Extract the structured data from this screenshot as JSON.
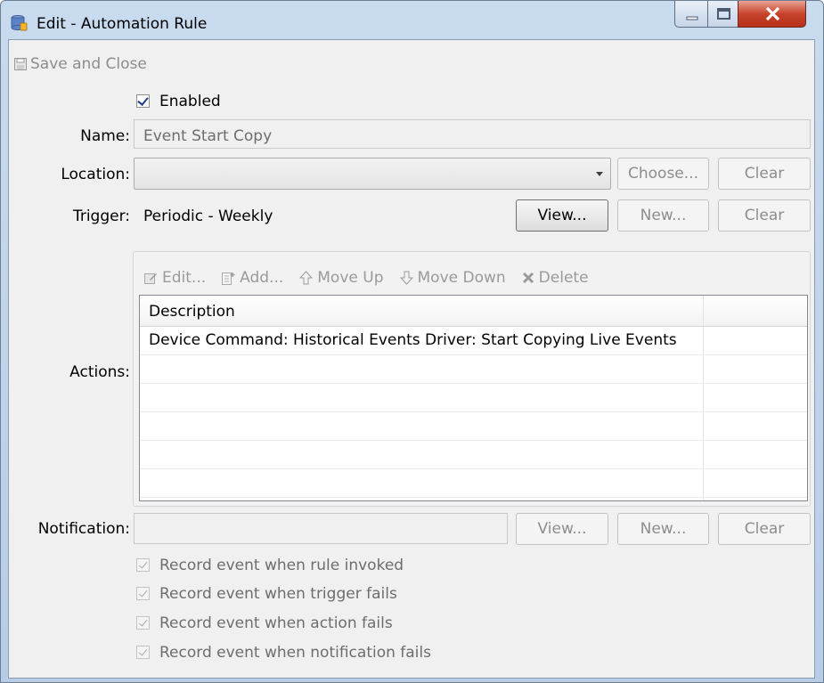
{
  "window": {
    "title": "Edit - Automation Rule",
    "min_icon": "minimize-icon",
    "max_icon": "maximize-icon",
    "close_icon": "close-icon",
    "close_color": "#c7422c"
  },
  "toolbar": {
    "save_close_label": "Save and Close"
  },
  "enabled": {
    "label": "Enabled",
    "checked": true
  },
  "name": {
    "label": "Name:",
    "value": "Event Start Copy"
  },
  "location": {
    "label": "Location:",
    "value": "",
    "choose_label": "Choose...",
    "clear_label": "Clear"
  },
  "trigger": {
    "label": "Trigger:",
    "value": "Periodic - Weekly",
    "view_label": "View...",
    "new_label": "New...",
    "clear_label": "Clear"
  },
  "actions": {
    "label": "Actions:",
    "toolbar": {
      "edit": "Edit...",
      "add": "Add...",
      "move_up": "Move Up",
      "move_down": "Move Down",
      "delete": "Delete"
    },
    "columns": [
      "Description",
      ""
    ],
    "rows": [
      "Device Command: Historical Events Driver: Start Copying Live Events",
      "",
      "",
      "",
      "",
      ""
    ]
  },
  "notification": {
    "label": "Notification:",
    "value": "",
    "view_label": "View...",
    "new_label": "New...",
    "clear_label": "Clear"
  },
  "record_options": [
    {
      "label": "Record event when rule invoked",
      "checked": true
    },
    {
      "label": "Record event when trigger fails",
      "checked": true
    },
    {
      "label": "Record event when action fails",
      "checked": true
    },
    {
      "label": "Record event when notification fails",
      "checked": true
    }
  ]
}
